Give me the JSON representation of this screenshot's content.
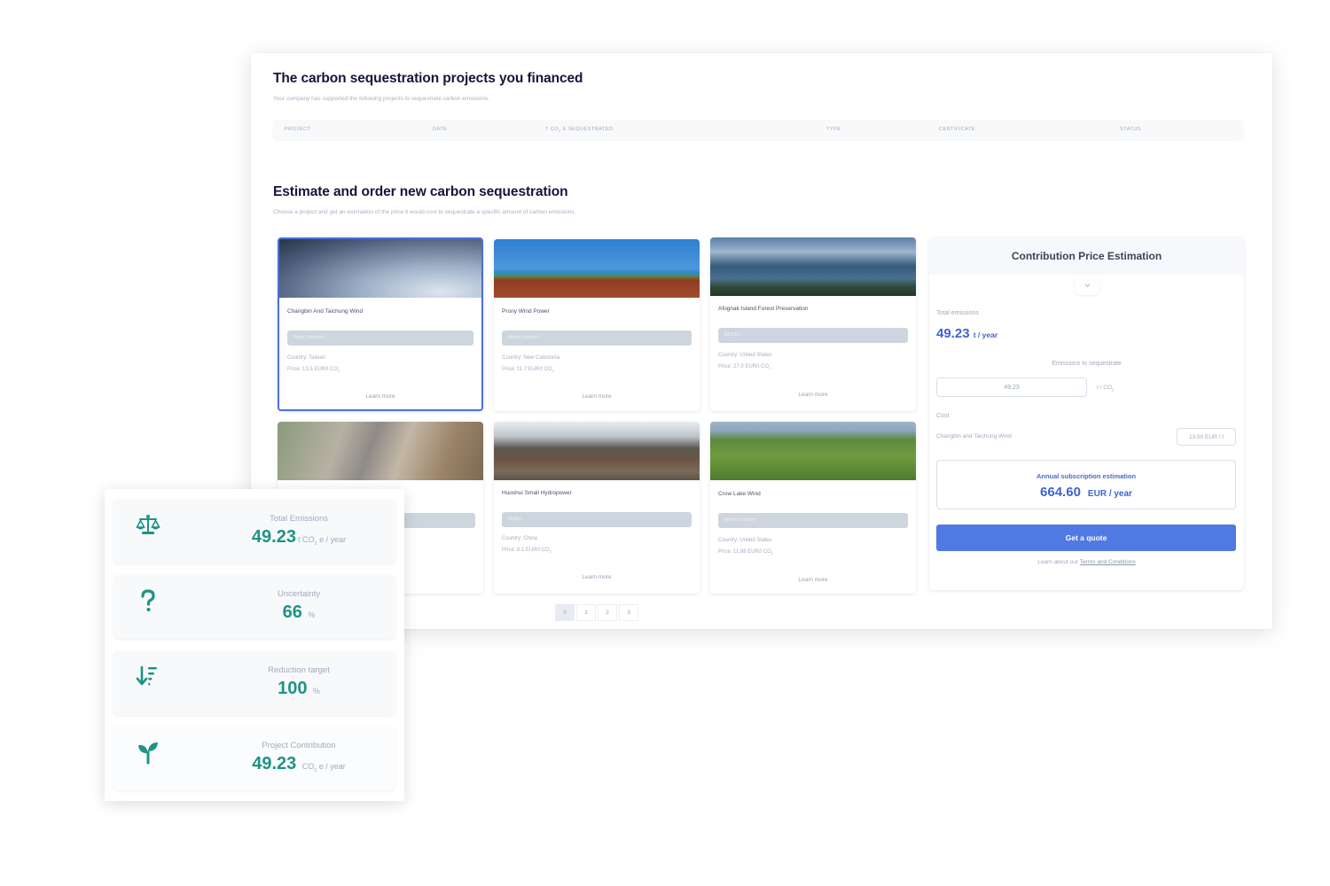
{
  "financed": {
    "title": "The carbon sequestration projects you financed",
    "subtitle": "Your company has supported the following projects to sequestrate carbon emissions.",
    "columns": {
      "project": "PROJECT",
      "date": "DATE",
      "sequestrated_prefix": "T CO",
      "sequestrated_sub": "2",
      "sequestrated_suffix": " E SEQUESTRATED",
      "type": "TYPE",
      "certificate": "CERTIFICATE",
      "status": "STATUS"
    }
  },
  "estimate": {
    "title": "Estimate and order new carbon sequestration",
    "subtitle": "Choose a project and get an estimation of the price it would cost to sequestrate a specific amount of carbon emissions."
  },
  "projects": [
    {
      "name": "Changbin And Taichung Wind",
      "type": "Wind Onshore",
      "country": "Country: Taiwan",
      "price": "Price: 13.5 EUR/t CO",
      "learn": "Learn more",
      "selected": true
    },
    {
      "name": "Prony Wind Power",
      "type": "Wind Onshore",
      "country": "Country: New Caledonia",
      "price": "Price: 11.7 EUR/t CO",
      "learn": "Learn more"
    },
    {
      "name": "Afognak Island Forest Preservation",
      "type": "REDD+",
      "country": "Country: United States",
      "price": "Price: 27.0 EUR/t CO",
      "learn": "Learn more"
    },
    {
      "name": "",
      "type": "",
      "country": "",
      "price": "",
      "learn": ""
    },
    {
      "name": "Huoshui Small Hydropower",
      "type": "Hydro",
      "country": "Country: China",
      "price": "Price: 8.1 EUR/t CO",
      "learn": "Learn more"
    },
    {
      "name": "Crow Lake Wind",
      "type": "Wind Onshore",
      "country": "Country: United States",
      "price": "Price: 11.88 EUR/t CO",
      "learn": "Learn more"
    }
  ],
  "co2_sub": "2",
  "pagination": {
    "pages": [
      "0",
      "1",
      "2",
      "3"
    ],
    "active": "0"
  },
  "estimation": {
    "title": "Contribution Price Estimation",
    "total_label": "Total emissions",
    "total_value": "49.23",
    "total_unit": "t / year",
    "sequestrate_label": "Emissions to sequestrate",
    "sequestrate_value": "49,23",
    "sequestrate_unit": "t / CO",
    "cost_label": "Cost",
    "cost_project": "Changbin and Taichung Wind",
    "cost_price": "13.50 EUR / t",
    "annual_label": "Annual subscription estimation",
    "annual_value": "664.60",
    "annual_unit": "EUR / year",
    "quote_button": "Get a quote",
    "terms_prefix": "Learn about our ",
    "terms_link": "Terms and Conditions"
  },
  "stats": [
    {
      "label": "Total Emissions",
      "value": "49.23",
      "unit_prefix": "t CO",
      "unit_suffix": " e / year",
      "icon": "scale-icon"
    },
    {
      "label": "Uncertainty",
      "value": "66",
      "unit_prefix": "%",
      "unit_suffix": "",
      "icon": "question-icon"
    },
    {
      "label": "Reduction target",
      "value": "100",
      "unit_prefix": "%",
      "unit_suffix": "",
      "icon": "sort-descending-icon"
    },
    {
      "label": "Project Contribution",
      "value": "49.23",
      "unit_prefix": "CO",
      "unit_suffix": " e / year",
      "icon": "sprout-icon"
    }
  ],
  "colors": {
    "accent_blue": "#5079e3",
    "value_blue": "#3e63d3",
    "teal": "#1e9385",
    "heading": "#14163a"
  }
}
